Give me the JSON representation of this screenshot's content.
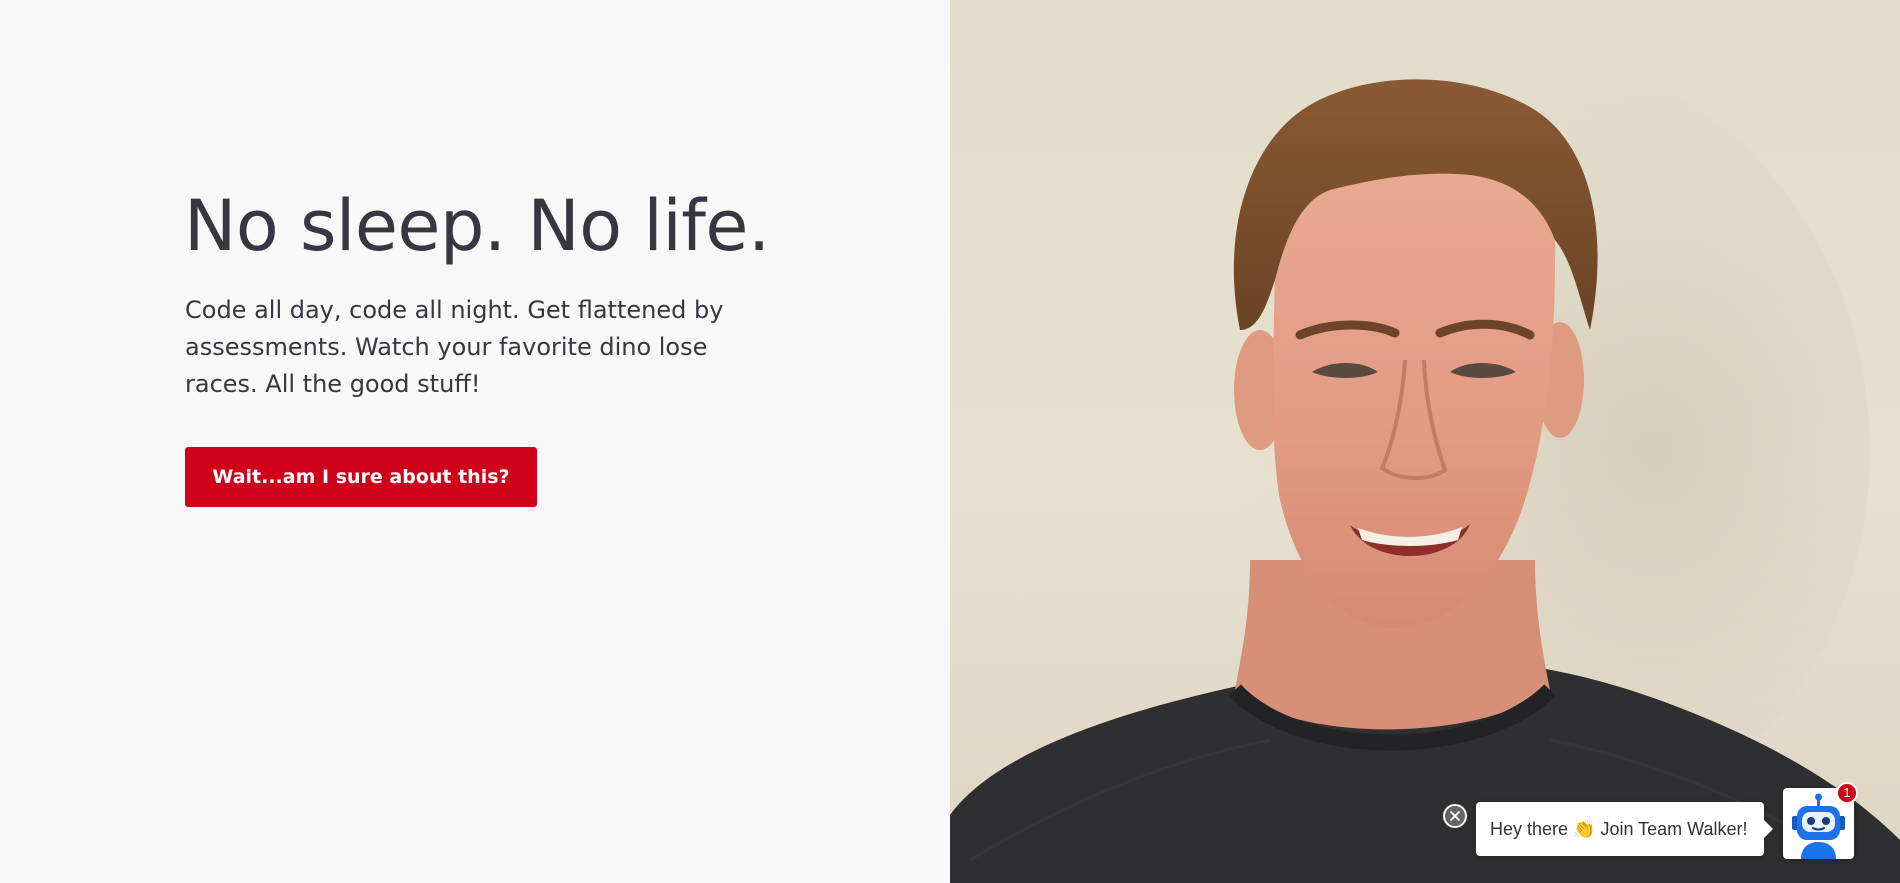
{
  "hero": {
    "title": "No sleep. No life.",
    "subtitle": "Code all day, code all night. Get flattened by assessments. Watch your favorite dino lose races. All the good stuff!",
    "cta_label": "Wait...am I sure about this?"
  },
  "photo": {
    "icon": "smiling-person-photo"
  },
  "chat_widget": {
    "message": "Hey there 👏 Join Team Walker!",
    "badge_count": "1",
    "close_icon": "close-icon",
    "avatar_icon": "robot-icon"
  },
  "colors": {
    "background": "#f8f8f8",
    "text": "#383641",
    "accent": "#d0021b",
    "robot_blue": "#1a73e8"
  }
}
